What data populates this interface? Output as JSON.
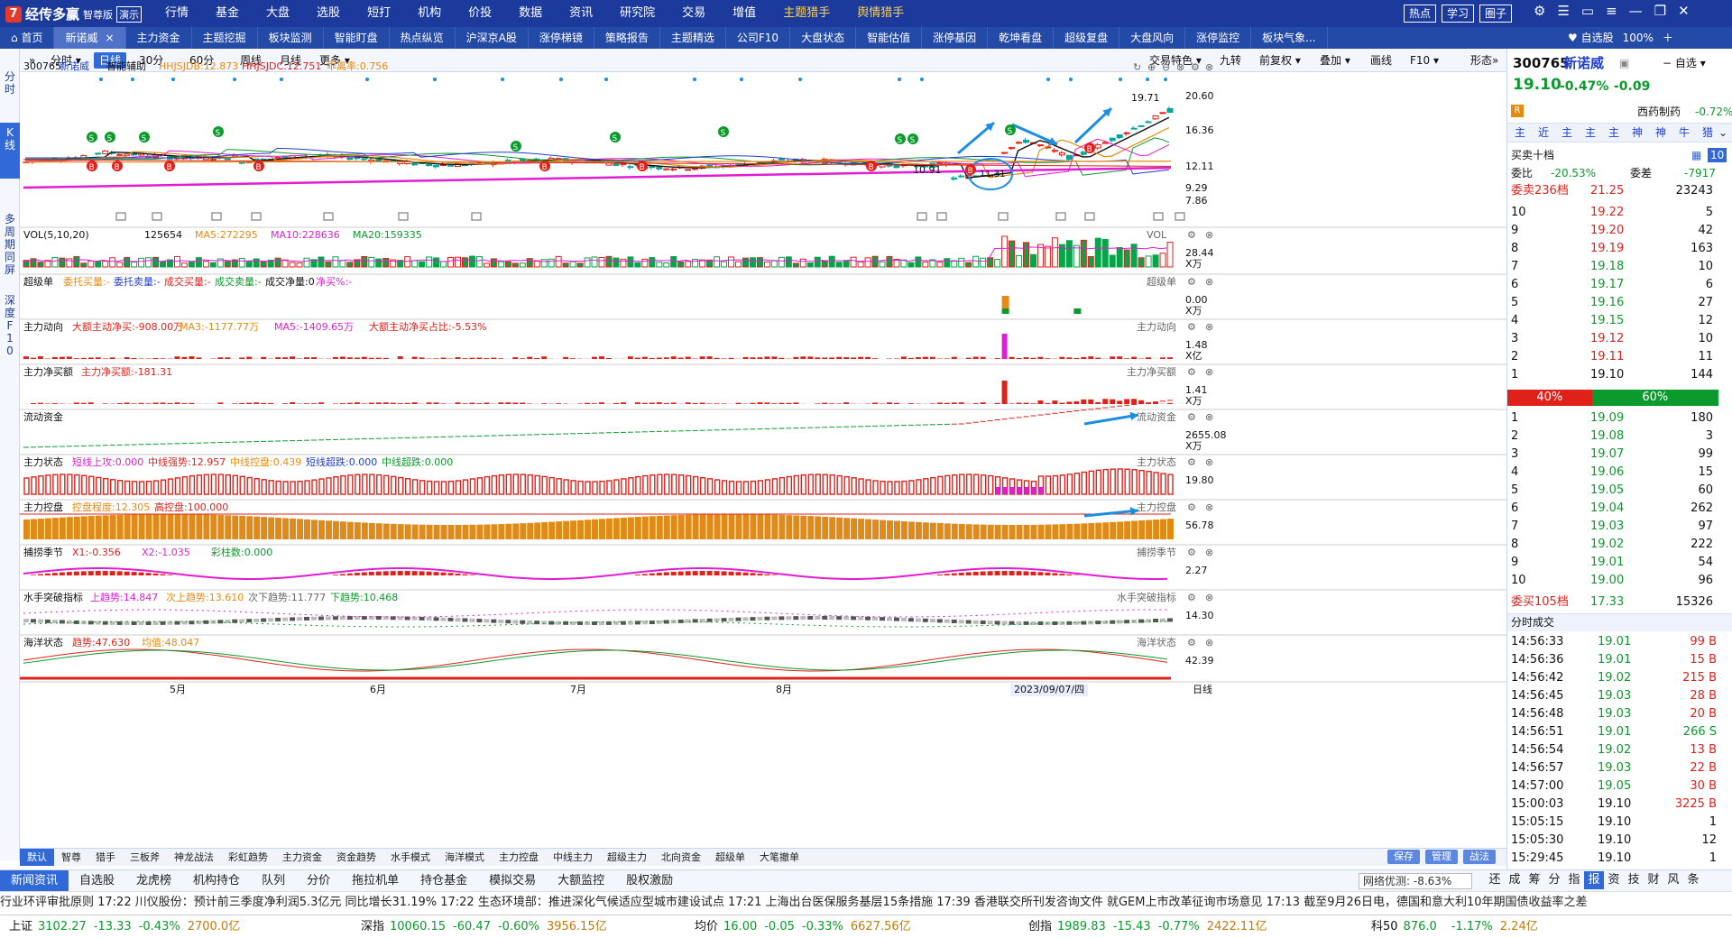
{
  "app": {
    "logo_text": "经传多赢",
    "edition": "智尊版",
    "demo": "演示"
  },
  "main_menu": [
    "行情",
    "基金",
    "大盘",
    "选股",
    "短打",
    "机构",
    "价投",
    "数据",
    "资讯",
    "研究院",
    "交易",
    "增值",
    "主题猎手",
    "舆情猎手"
  ],
  "top_right_buttons": [
    "热点",
    "学习",
    "圈子"
  ],
  "tabs": [
    {
      "label": "首页"
    },
    {
      "label": "新诺威",
      "active": true
    },
    {
      "label": "主力资金"
    },
    {
      "label": "主题挖掘"
    },
    {
      "label": "板块监测"
    },
    {
      "label": "智能盯盘"
    },
    {
      "label": "热点纵览"
    },
    {
      "label": "沪深京A股"
    },
    {
      "label": "涨停梯镜"
    },
    {
      "label": "策略报告"
    },
    {
      "label": "主题精选"
    },
    {
      "label": "公司F10"
    },
    {
      "label": "大盘状态"
    },
    {
      "label": "智能估值"
    },
    {
      "label": "涨停基因"
    },
    {
      "label": "乾坤看盘"
    },
    {
      "label": "超级复盘"
    },
    {
      "label": "大盘风向"
    },
    {
      "label": "涨停监控"
    },
    {
      "label": "板块气象..."
    }
  ],
  "tab_right": {
    "watchlist": "自选股",
    "zoom": "100%"
  },
  "left_strip": [
    "分时",
    "K线",
    "多周期同屏",
    "深度F10"
  ],
  "toolbar": {
    "periods": [
      "分时",
      "日线",
      "30分",
      "60分",
      "周线",
      "月线",
      "更多"
    ],
    "active_period": "日线",
    "right": [
      "交易特色",
      "九转",
      "前复权",
      "叠加",
      "画线",
      "F10",
      "形态"
    ]
  },
  "kline": {
    "code": "300765",
    "name": "新诺威",
    "assist": "智能辅助",
    "hhjsjdb": "HHJSJDB:12.873",
    "hhjsjdc": "HHJSJDC:12.751",
    "qcl": "乖离率:0.756",
    "axis": [
      "20.60",
      "16.36",
      "12.11",
      "9.29",
      "7.86"
    ],
    "high_mark": "19.71",
    "low_mark": "10.91",
    "low_mark2": "11.31"
  },
  "panels": [
    {
      "title": "VOL(5,10,20)",
      "items": [
        {
          "t": "125654",
          "c": "black"
        },
        {
          "t": "MA5:272295",
          "c": "orange"
        },
        {
          "t": "MA10:228636",
          "c": "mag"
        },
        {
          "t": "MA20:159335",
          "c": "green"
        }
      ],
      "right": "VOL",
      "axis": "28.44",
      "unit": "X万"
    },
    {
      "title": "超级单",
      "items": [
        {
          "t": "委托买量:-",
          "c": "orange"
        },
        {
          "t": "委托卖量:-",
          "c": "blue"
        },
        {
          "t": "成交买量:-",
          "c": "red"
        },
        {
          "t": "成交卖量:-",
          "c": "green"
        },
        {
          "t": "成交净量:0",
          "c": "black"
        },
        {
          "t": "净买%:-",
          "c": "mag"
        }
      ],
      "right": "超级单",
      "axis": "0.00",
      "unit": "X万"
    },
    {
      "title": "主力动向",
      "items": [
        {
          "t": "大额主动净买:-908.00万",
          "c": "red"
        },
        {
          "t": "MA3:-1177.77万",
          "c": "orange"
        },
        {
          "t": "MA5:-1409.65万",
          "c": "mag"
        },
        {
          "t": "大额主动净买占比:-5.53%",
          "c": "red"
        }
      ],
      "right": "主力动向",
      "axis": "1.48",
      "unit": "X亿"
    },
    {
      "title": "主力净买额",
      "items": [
        {
          "t": "主力净买额:-181.31",
          "c": "red"
        }
      ],
      "right": "主力净买额",
      "axis": "1.41",
      "unit": "X万"
    },
    {
      "title": "流动资金",
      "items": [],
      "right": "流动资金",
      "axis": "2655.08",
      "unit": "X万"
    },
    {
      "title": "主力状态",
      "items": [
        {
          "t": "短线上攻:0.000",
          "c": "mag"
        },
        {
          "t": "中线强势:12.957",
          "c": "red"
        },
        {
          "t": "中线控盘:0.439",
          "c": "orange"
        },
        {
          "t": "短线超跌:0.000",
          "c": "blue"
        },
        {
          "t": "中线超跌:0.000",
          "c": "green"
        }
      ],
      "right": "主力状态",
      "axis": "19.80",
      "unit": ""
    },
    {
      "title": "主力控盘",
      "items": [
        {
          "t": "控盘程度:12.305",
          "c": "orange"
        },
        {
          "t": "高控盘:100.000",
          "c": "red"
        }
      ],
      "right": "主力控盘",
      "axis": "56.78",
      "unit": ""
    },
    {
      "title": "捕捞季节",
      "items": [
        {
          "t": "X1:-0.356",
          "c": "red"
        },
        {
          "t": "X2:-1.035",
          "c": "mag"
        },
        {
          "t": "彩柱数:0.000",
          "c": "green"
        }
      ],
      "right": "捕捞季节",
      "axis": "2.27",
      "unit": ""
    },
    {
      "title": "水手突破指标",
      "items": [
        {
          "t": "上趋势:14.847",
          "c": "mag"
        },
        {
          "t": "次上趋势:13.610",
          "c": "orange"
        },
        {
          "t": "次下趋势:11.777",
          "c": "gray"
        },
        {
          "t": "下趋势:10.468",
          "c": "green"
        }
      ],
      "right": "水手突破指标",
      "axis": "14.30",
      "unit": ""
    },
    {
      "title": "海洋状态",
      "items": [
        {
          "t": "趋势:47.630",
          "c": "red"
        },
        {
          "t": "均值:48.047",
          "c": "orange"
        }
      ],
      "right": "海洋状态",
      "axis": "42.39",
      "unit": ""
    }
  ],
  "xaxis": {
    "months": [
      "5月",
      "6月",
      "7月",
      "8月"
    ],
    "cursor_date": "2023/09/07/四",
    "right": "日线"
  },
  "bottom_tabs": [
    "默认",
    "智尊",
    "猎手",
    "三板斧",
    "神龙战法",
    "彩虹趋势",
    "主力资金",
    "资金趋势",
    "水手模式",
    "海洋模式",
    "主力控盘",
    "中线主力",
    "超级主力",
    "北向资金",
    "超级单",
    "大笔撤单"
  ],
  "bottom_right_btns": [
    "保存",
    "管理",
    "战法"
  ],
  "news_tabs": [
    "新闻资讯",
    "自选股",
    "龙虎榜",
    "机构持仓",
    "队列",
    "分价",
    "拖拉机单",
    "持仓基金",
    "模拟交易",
    "大额监控",
    "股权激励"
  ],
  "net_opt": "网络优测: -8.63%",
  "nav_icons": [
    "还",
    "成",
    "筹",
    "分",
    "指",
    "报",
    "资",
    "技",
    "财",
    "风",
    "条"
  ],
  "ticker": "行业环评审批原则     17:22 川仪股份：预计前三季度净利润5.3亿元 同比增长31.19%     17:22 生态环境部：推进深化气候适应型城市建设试点     17:21 上海出台医保服务基层15条措施     17:39 香港联交所刊发咨询文件 就GEM上市改革征询市场意见     17:13 截至9月26日电，德国和意大利10年期国债收益率之差",
  "indexbar": [
    {
      "name": "上证",
      "val": "3102.27",
      "chg": "-13.33",
      "pct": "-0.43%",
      "amt": "2700.0亿"
    },
    {
      "name": "深指",
      "val": "10060.15",
      "chg": "-60.47",
      "pct": "-0.60%",
      "amt": "3956.15亿"
    },
    {
      "name": "均价",
      "val": "16.00",
      "chg": "-0.05",
      "pct": "-0.33%",
      "amt": "6627.56亿"
    },
    {
      "name": "创指",
      "val": "1989.83",
      "chg": "-15.43",
      "pct": "-0.77%",
      "amt": "2422.11亿"
    },
    {
      "name": "科50",
      "val": "876.0",
      "chg": "",
      "pct": "-1.17%",
      "amt": "2.24亿"
    }
  ],
  "quote": {
    "code": "300765",
    "name": "新诺威",
    "watch": "自选",
    "price": "19.10",
    "pct": "-0.47%",
    "chg": "-0.09",
    "sector": "西药制药",
    "sector_pct": "-0.72%",
    "tools": [
      "主",
      "近",
      "主",
      "主",
      "主",
      "神",
      "神",
      "牛",
      "猎"
    ],
    "title": "买卖十档",
    "wb_label": "委比",
    "wb": "-20.53%",
    "wc_label": "委差",
    "wc": "-7917",
    "sell_total_label": "委卖236档",
    "sell_total_price": "21.25",
    "sell_total_vol": "23243",
    "asks": [
      {
        "i": "10",
        "p": "19.22",
        "v": "5"
      },
      {
        "i": "9",
        "p": "19.20",
        "v": "42"
      },
      {
        "i": "8",
        "p": "19.19",
        "v": "163"
      },
      {
        "i": "7",
        "p": "19.18",
        "v": "10"
      },
      {
        "i": "6",
        "p": "19.17",
        "v": "6"
      },
      {
        "i": "5",
        "p": "19.16",
        "v": "27"
      },
      {
        "i": "4",
        "p": "19.15",
        "v": "12"
      },
      {
        "i": "3",
        "p": "19.12",
        "v": "10"
      },
      {
        "i": "2",
        "p": "19.11",
        "v": "11"
      },
      {
        "i": "1",
        "p": "19.10",
        "v": "144"
      }
    ],
    "ratio_sell": "40%",
    "ratio_buy": "60%",
    "ratio_fraction": 0.4,
    "bids": [
      {
        "i": "1",
        "p": "19.09",
        "v": "180"
      },
      {
        "i": "2",
        "p": "19.08",
        "v": "3"
      },
      {
        "i": "3",
        "p": "19.07",
        "v": "99"
      },
      {
        "i": "4",
        "p": "19.06",
        "v": "15"
      },
      {
        "i": "5",
        "p": "19.05",
        "v": "60"
      },
      {
        "i": "6",
        "p": "19.04",
        "v": "262"
      },
      {
        "i": "7",
        "p": "19.03",
        "v": "97"
      },
      {
        "i": "8",
        "p": "19.02",
        "v": "222"
      },
      {
        "i": "9",
        "p": "19.01",
        "v": "54"
      },
      {
        "i": "10",
        "p": "19.00",
        "v": "96"
      }
    ],
    "buy_total_label": "委买105档",
    "buy_total_price": "17.33",
    "buy_total_vol": "15326",
    "trades_title": "分时成交",
    "trades": [
      {
        "t": "14:56:33",
        "p": "19.01",
        "v": "99 B"
      },
      {
        "t": "14:56:36",
        "p": "19.01",
        "v": "15 B"
      },
      {
        "t": "14:56:42",
        "p": "19.02",
        "v": "215 B"
      },
      {
        "t": "14:56:45",
        "p": "19.03",
        "v": "28 B"
      },
      {
        "t": "14:56:48",
        "p": "19.03",
        "v": "20 B"
      },
      {
        "t": "14:56:51",
        "p": "19.01",
        "v": "266 S"
      },
      {
        "t": "14:56:54",
        "p": "19.02",
        "v": "13 B"
      },
      {
        "t": "14:56:57",
        "p": "19.03",
        "v": "22 B"
      },
      {
        "t": "14:57:00",
        "p": "19.05",
        "v": "30 B"
      },
      {
        "t": "15:00:03",
        "p": "19.10",
        "v": "3225 B"
      },
      {
        "t": "15:05:15",
        "p": "19.10",
        "v": "1"
      },
      {
        "t": "15:05:30",
        "p": "19.10",
        "v": "12"
      },
      {
        "t": "15:29:45",
        "p": "19.10",
        "v": "1"
      }
    ]
  }
}
